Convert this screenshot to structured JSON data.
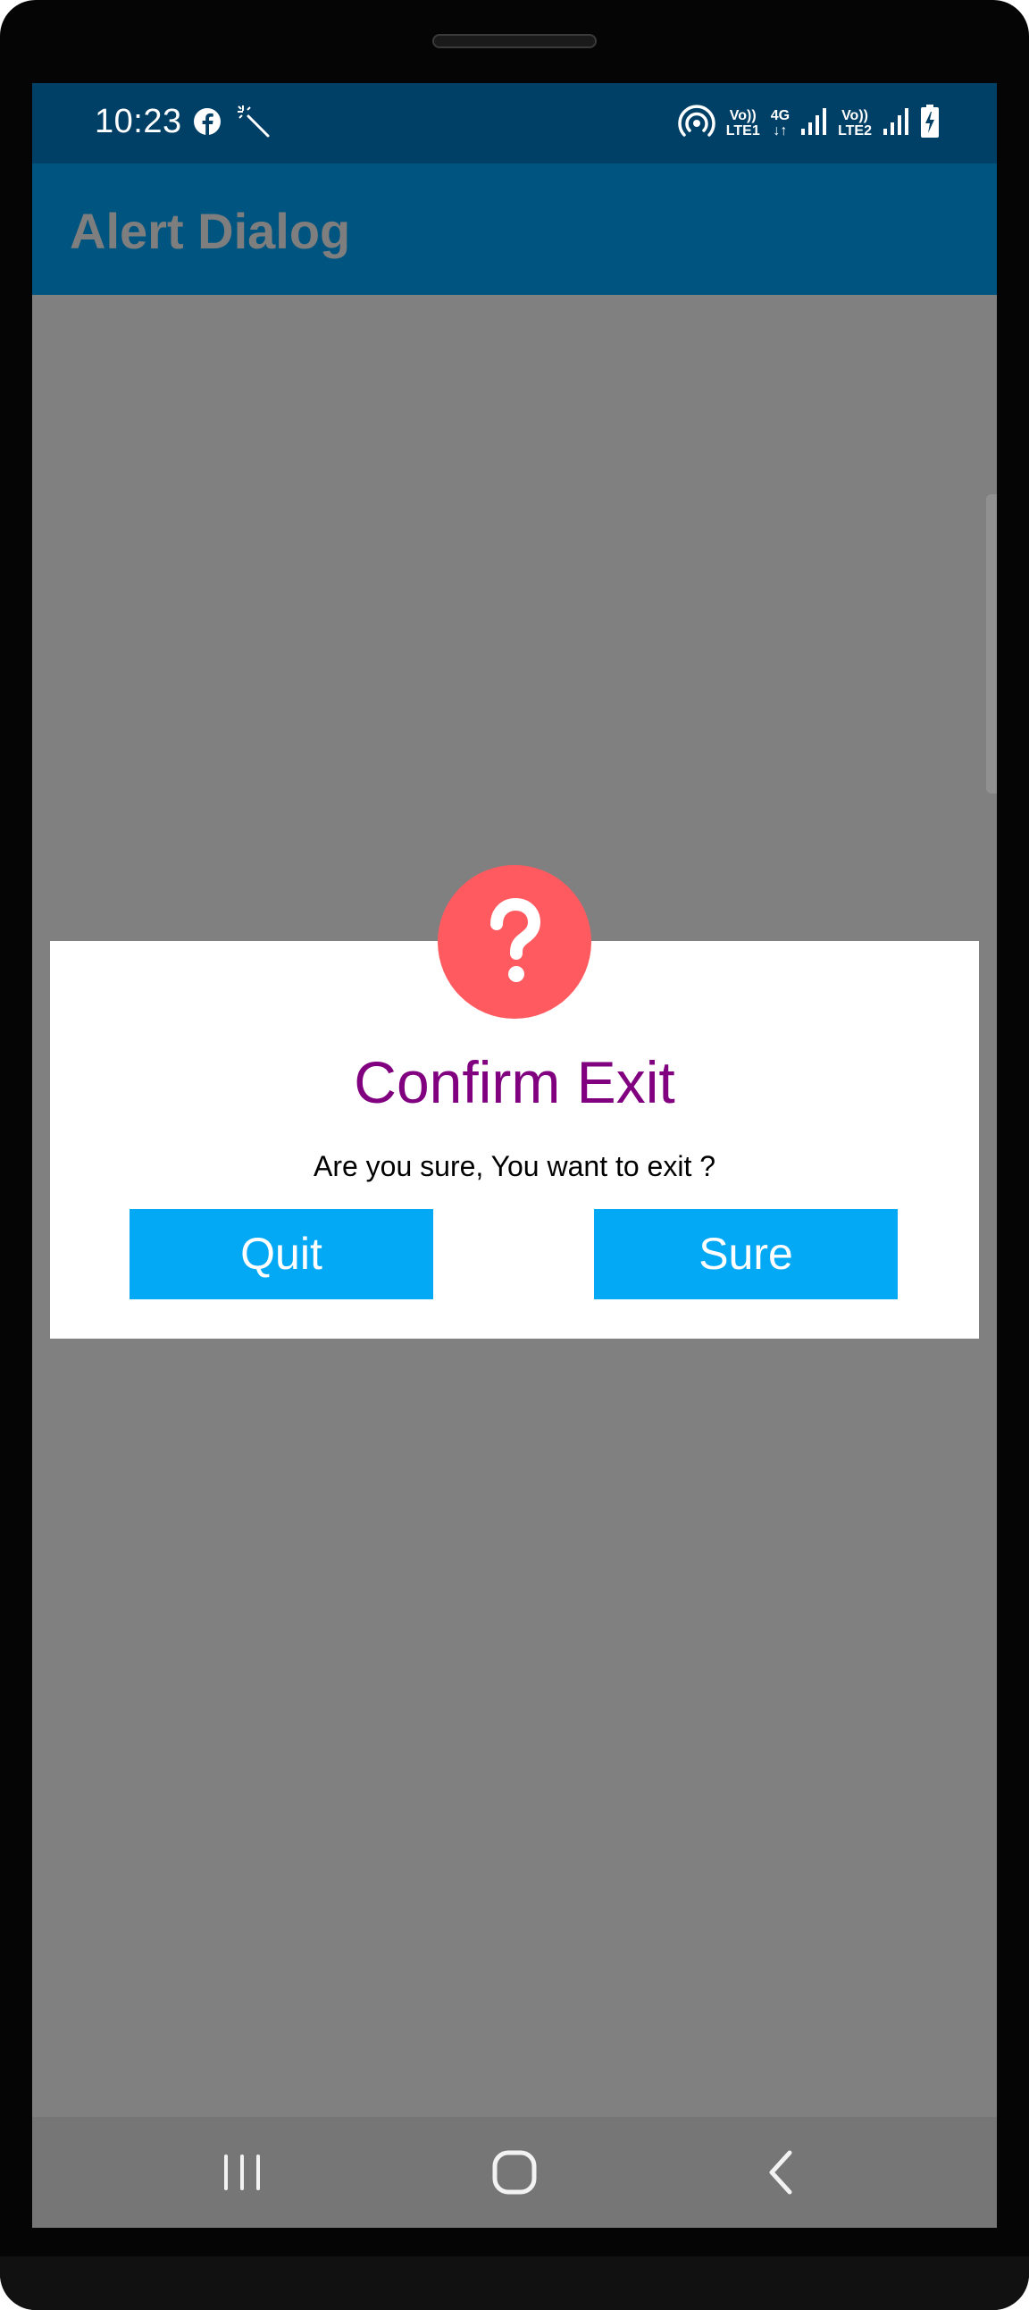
{
  "status_bar": {
    "time": "10:23",
    "left_icons": [
      "facebook-icon",
      "magic-wand-icon"
    ],
    "right_icons": [
      "hotspot-icon",
      "volte-lte1-icon",
      "4g-data-icon",
      "signal-icon",
      "volte-lte2-icon",
      "signal-icon",
      "battery-charging-icon"
    ],
    "sim1_top": "Vo))",
    "sim1_bottom": "LTE1",
    "data_top": "4G",
    "data_bottom": "↓↑",
    "sim2_top": "Vo))",
    "sim2_bottom": "LTE2"
  },
  "app_bar": {
    "title": "Alert Dialog"
  },
  "dialog": {
    "icon": "question-mark-icon",
    "icon_glyph": "?",
    "title": "Confirm Exit",
    "message": "Are you sure, You want to exit ?",
    "buttons": {
      "quit": "Quit",
      "sure": "Sure"
    }
  },
  "nav_bar": {
    "buttons": [
      "recents-icon",
      "home-icon",
      "back-icon"
    ]
  },
  "colors": {
    "status_bar": "#004066",
    "app_bar": "#005580",
    "scrim": "#808080",
    "dialog_icon": "#ff5a5f",
    "dialog_title": "#800080",
    "button": "#03a9f4"
  }
}
